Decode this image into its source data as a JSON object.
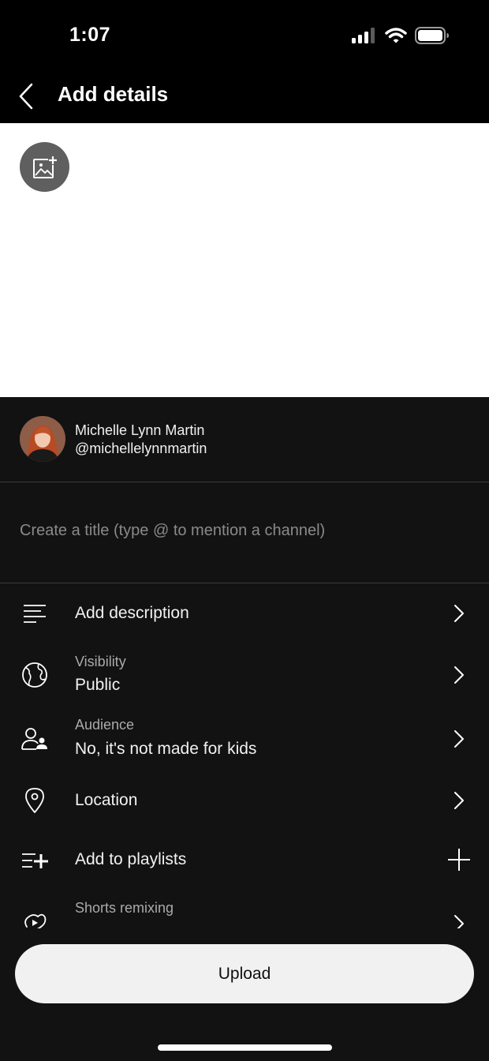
{
  "status_bar": {
    "time": "1:07",
    "icons": [
      "cellular-signal-icon",
      "wifi-icon",
      "battery-icon"
    ]
  },
  "header": {
    "title": "Add details",
    "back_icon": "chevron-left-icon"
  },
  "preview": {
    "thumbnail_icon": "add-thumbnail-icon",
    "background": "#ffffff"
  },
  "account": {
    "name": "Michelle Lynn Martin",
    "handle": "@michellelynnmartin"
  },
  "title_field": {
    "value": "",
    "placeholder": "Create a title (type @ to mention a channel)"
  },
  "settings": {
    "description": {
      "label": "Add description",
      "icon": "description-lines-icon"
    },
    "visibility": {
      "label": "Visibility",
      "value": "Public",
      "icon": "globe-icon"
    },
    "audience": {
      "label": "Audience",
      "value": "No, it's not made for kids",
      "icon": "audience-icon"
    },
    "location": {
      "label": "Location",
      "icon": "location-pin-icon"
    },
    "playlists": {
      "label": "Add to playlists",
      "icon": "playlist-add-icon"
    },
    "remixing": {
      "label": "Shorts remixing",
      "icon": "remix-icon"
    }
  },
  "upload": {
    "label": "Upload"
  },
  "colors": {
    "background": "#121212",
    "bar": "#000000",
    "text": "#f1f1f1",
    "secondary_text": "#aaaaaa",
    "divider": "#3a3a3a",
    "upload_button": "#f1f1f1"
  }
}
